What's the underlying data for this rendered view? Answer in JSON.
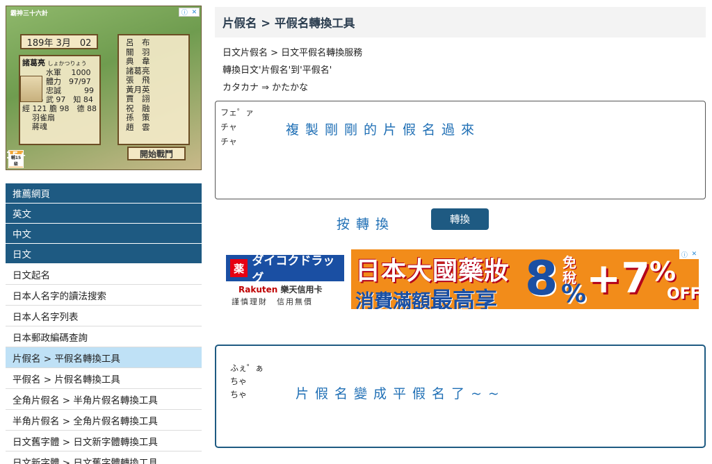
{
  "game_ad": {
    "title": "霸神三十六計",
    "date": "189年 3月　02",
    "general_name": "諸葛亮",
    "general_reading": "しょかつりょう",
    "stats": [
      "水軍　 1000",
      "體力　97/97",
      "忠誠　　　99",
      "LV　5 武 97　知 84",
      "經 121 膽 98　德 88",
      "羽雀扇",
      "蔣魂"
    ],
    "roster": [
      "呂　布",
      "關　羽",
      "典　韋",
      "諸葛亮",
      "張　飛",
      "黃月英",
      "賈　詡",
      "祝　融",
      "孫　策",
      "趙　雲"
    ],
    "start_button": "開始戰鬥",
    "rating": "15+",
    "rating_sub": "輔15級"
  },
  "nav": {
    "items": [
      {
        "label": "推薦網頁",
        "type": "cat",
        "active": false
      },
      {
        "label": "英文",
        "type": "cat",
        "active": false
      },
      {
        "label": "中文",
        "type": "cat",
        "active": false
      },
      {
        "label": "日文",
        "type": "cat",
        "active": false
      },
      {
        "label": "日文起名",
        "type": "item",
        "active": false
      },
      {
        "label": "日本人名字的讀法搜索",
        "type": "item",
        "active": false
      },
      {
        "label": "日本人名字列表",
        "type": "item",
        "active": false
      },
      {
        "label": "日本郵政編碼查詢",
        "type": "item",
        "active": false
      },
      {
        "label": "片假名 > 平假名轉換工具",
        "type": "item",
        "active": true
      },
      {
        "label": "平假名 > 片假名轉換工具",
        "type": "item",
        "active": false
      },
      {
        "label": "全角片假名 > 半角片假名轉換工具",
        "type": "item",
        "active": false
      },
      {
        "label": "半角片假名 > 全角片假名轉換工具",
        "type": "item",
        "active": false
      },
      {
        "label": "日文舊字體 > 日文新字體轉換工具",
        "type": "item",
        "active": false
      },
      {
        "label": "日文新字體 > 日文舊字體轉換工具",
        "type": "item",
        "active": false
      }
    ]
  },
  "main": {
    "title": "片假名 > 平假名轉換工具",
    "desc": [
      "日文片假名 > 日文平假名轉換服務",
      "轉換日文'片假名'到'平假名'",
      "カタカナ ⇒ かたかな"
    ],
    "input_text": "フェ゜ァ\nチャ\nチャ",
    "input_hint": "複製剛剛的片假名過來",
    "convert_hint": "按轉換",
    "convert_button": "轉換",
    "output_text": "ふぇ゜ぁ\nちゃ\nちゃ",
    "output_hint": "片假名變成平假名了~~"
  },
  "banner_ad": {
    "brand": "ダイコクドラッグ",
    "brand_kanji": "薬",
    "rakuten": "Rakuten",
    "rakuten_card": "樂天信用卡",
    "note": "謹慎理財　信用無價",
    "headline": "日本大國藥妝",
    "subline_a": "消費滿額",
    "subline_b": "最高享",
    "big_number": "8",
    "tax_free": "免稅",
    "percent_a": "%",
    "plus_seven": "+7",
    "percent_b": "%",
    "off": "OFF"
  },
  "colors": {
    "nav_cat_bg": "#1e5a82",
    "nav_active_bg": "#bfe1f6",
    "button_bg": "#1e5a82",
    "hint_color": "#1f6fb5",
    "ad_orange": "#f28c1a"
  }
}
